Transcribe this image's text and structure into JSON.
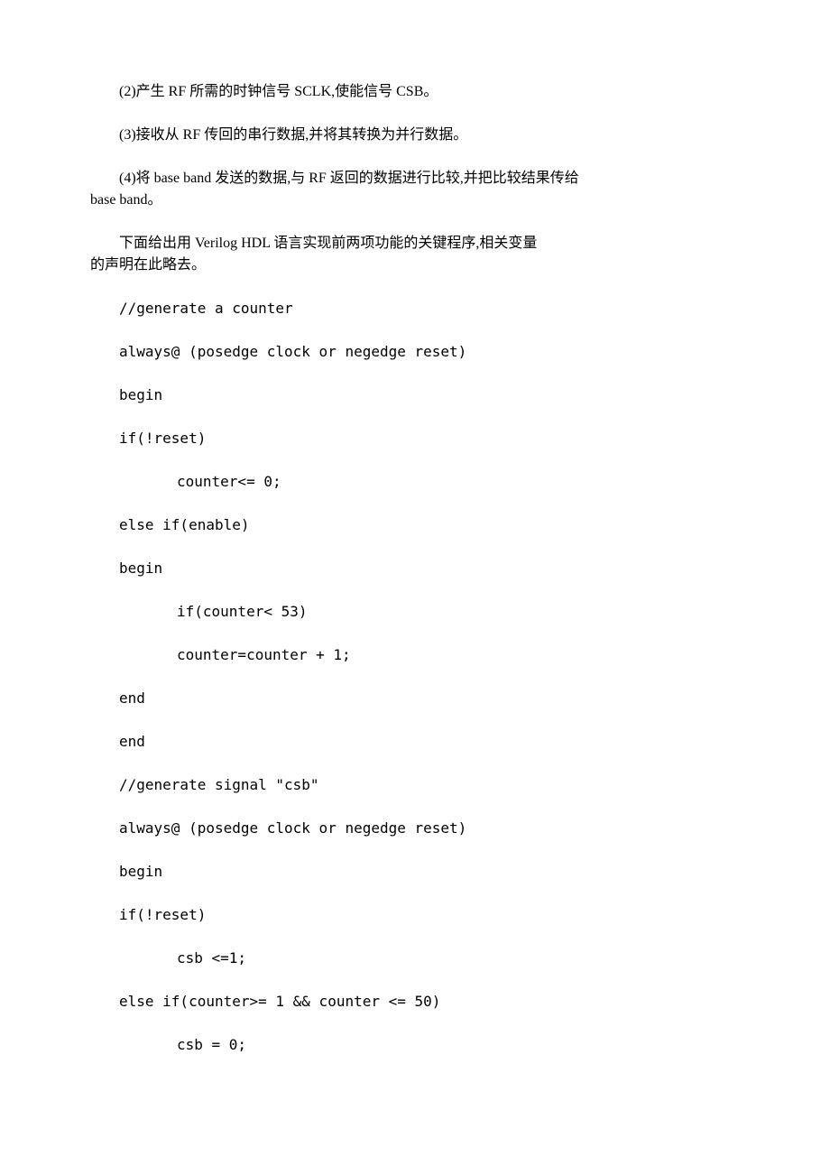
{
  "p1": "(2)产生 RF 所需的时钟信号 SCLK,使能信号 CSB。",
  "p2": "(3)接收从 RF 传回的串行数据,并将其转换为并行数据。",
  "p3a": "(4)将 base band 发送的数据,与 RF 返回的数据进行比较,并把比较结果传给",
  "p3b": "base band。",
  "p4a": "    下面给出用 Verilog HDL 语言实现前两项功能的关键程序,相关变量",
  "p4b": "的声明在此略去。",
  "code": {
    "l1": "//generate a counter",
    "l2": "always@ (posedge clock or negedge reset)",
    "l3": "begin",
    "l4": "if(!reset)",
    "l5": "counter<= 0;",
    "l6": "else if(enable)",
    "l7": "begin",
    "l8": "if(counter< 53)",
    "l9": "counter=counter + 1;",
    "l10": "end",
    "l11": "end",
    "l12": "//generate signal \"csb\"",
    "l13": "always@ (posedge clock or negedge reset)",
    "l14": "begin",
    "l15": "if(!reset)",
    "l16": "csb <=1;",
    "l17": "else if(counter>= 1 && counter <= 50)",
    "l18": "csb = 0;"
  }
}
